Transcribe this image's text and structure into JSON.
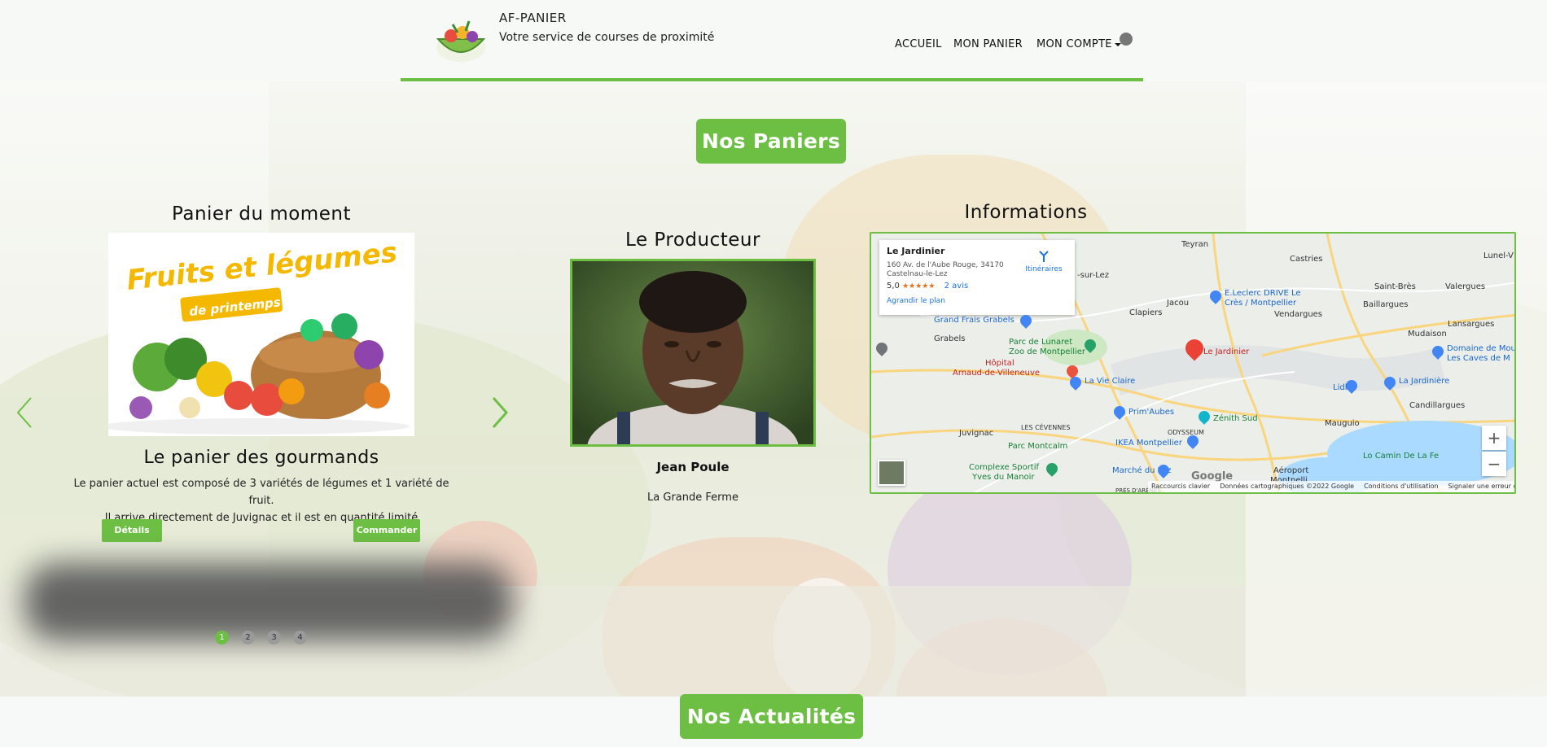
{
  "header": {
    "site_name": "AF-PANIER",
    "site_subtitle": "Votre service de courses de proximité",
    "nav": {
      "accueil": "ACCUEIL",
      "panier": "MON PANIER",
      "compte": "MON COMPTE"
    }
  },
  "sections": {
    "paniers_title": "Nos Paniers",
    "actualites_title": "Nos Actualités"
  },
  "basket": {
    "heading": "Panier du moment",
    "image_text_line1": "Fruits et légumes",
    "image_text_line2": "de printemps",
    "title": "Le panier des gourmands",
    "desc_line1": "Le panier actuel est composé de 3 variétés de légumes et 1 variété de fruit.",
    "desc_line2": "Il arrive directement de Juvignac et il est en quantité limité",
    "details_label": "Détails",
    "order_label": "Commander",
    "pages": [
      "1",
      "2",
      "3",
      "4"
    ],
    "active_page": 1
  },
  "producer": {
    "heading": "Le Producteur",
    "name": "Jean Poule",
    "farm": "La Grande Ferme"
  },
  "info": {
    "heading": "Informations",
    "place": {
      "name": "Le Jardinier",
      "address_line1": "160 Av. de l'Aube Rouge, 34170",
      "address_line2": "Castelnau-le-Lez",
      "rating": "5,0",
      "stars": "★★★★★",
      "reviews": "2 avis",
      "directions": "Itinéraires",
      "enlarge": "Agrandir le plan"
    },
    "map_labels": {
      "teyran": "Teyran",
      "castries": "Castries",
      "lunel": "Lunel-V",
      "sur_lez": "-sur-Lez",
      "jacou": "Jacou",
      "leclerc1": "E.Leclerc DRIVE Le",
      "leclerc2": "Crès / Montpellier",
      "saint_bres": "Saint-Brès",
      "valergues": "Valergues",
      "baillargues": "Baillargues",
      "clapiers": "Clapiers",
      "vendargues": "Vendargues",
      "lansargues": "Lansargues",
      "grand_frais": "Grand Frais Grabels",
      "grabels": "Grabels",
      "lunaret1": "Parc de Lunaret",
      "lunaret2": "Zoo de Montpellier",
      "mudaison": "Mudaison",
      "domaine1": "Domaine de Mou",
      "domaine2": "Les Caves de M",
      "hopital1": "Hôpital",
      "hopital2": "Arnaud-de-Villeneuve",
      "vie_claire": "La Vie Claire",
      "le_jardinier": "Le Jardinier",
      "lidl": "Lidl",
      "jardiniere": "La Jardinière",
      "candillargues": "Candillargues",
      "prim_aubes": "Prim'Aubes",
      "zenith": "Zénith Sud",
      "cevennes": "LES CÉVENNES",
      "odysseum": "ODYSSEUM",
      "juvignac": "Juvignac",
      "ikea": "IKEA Montpellier",
      "mauguio": "Mauguio",
      "montcalm": "Parc Montcalm",
      "camin": "Lo Camin De La Fe",
      "complexe1": "Complexe Sportif",
      "complexe2": "Yves du Manoir",
      "marche": "Marché du Lez",
      "aeroport1": "Aéroport",
      "aeroport2": "Montpelli",
      "pres": "PRÉS D'ARÈNES"
    },
    "map_footer": {
      "shortcuts": "Raccourcis clavier",
      "data": "Données cartographiques ©2022 Google",
      "terms": "Conditions d'utilisation",
      "report": "Signaler une erreur cartographique"
    },
    "google": "Google",
    "zoom_in": "+",
    "zoom_out": "−"
  },
  "colors": {
    "accent": "#6cbf43"
  }
}
